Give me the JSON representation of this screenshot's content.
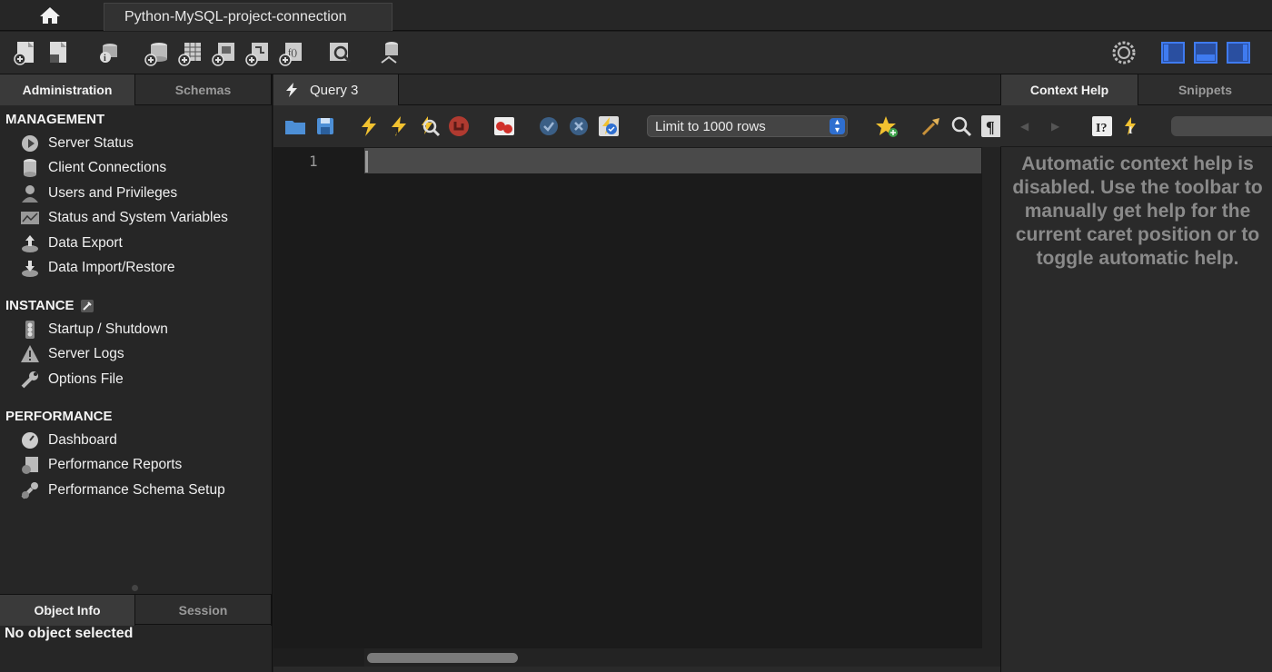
{
  "titlebar": {
    "home_icon": "home-icon",
    "connection_tab": "Python-MySQL-project-connection"
  },
  "main_toolbar": {
    "icons": [
      "new-sql-tab-icon",
      "open-sql-script-icon",
      "inspector-icon",
      "create-schema-icon",
      "create-table-icon",
      "create-view-icon",
      "create-procedure-icon",
      "create-function-icon",
      "search-table-data-icon",
      "reconnect-icon",
      "settings-icon",
      "toggle-sidebar-icon",
      "toggle-output-icon",
      "toggle-secondary-sidebar-icon"
    ]
  },
  "left_panel": {
    "tabs": [
      "Administration",
      "Schemas"
    ],
    "active_tab": "Administration",
    "management": {
      "title": "MANAGEMENT",
      "items": [
        "Server Status",
        "Client Connections",
        "Users and Privileges",
        "Status and System Variables",
        "Data Export",
        "Data Import/Restore"
      ]
    },
    "instance": {
      "title": "INSTANCE",
      "items": [
        "Startup / Shutdown",
        "Server Logs",
        "Options File"
      ]
    },
    "performance": {
      "title": "PERFORMANCE",
      "items": [
        "Dashboard",
        "Performance Reports",
        "Performance Schema Setup"
      ]
    },
    "bottom_tabs": [
      "Object Info",
      "Session"
    ],
    "object_info": "No object selected"
  },
  "editor": {
    "tab_label": "Query 3",
    "limit_select": "Limit to 1000 rows",
    "line_number": "1"
  },
  "right_panel": {
    "tabs": [
      "Context Help",
      "Snippets"
    ],
    "active_tab": "Context Help",
    "help_text": "Automatic context help is disabled. Use the toolbar to manually get help for the current caret position or to toggle automatic help."
  },
  "colors": {
    "accent_blue": "#2f6fd0",
    "execute_yellow": "#f2c230",
    "stop_red": "#c0392b"
  }
}
